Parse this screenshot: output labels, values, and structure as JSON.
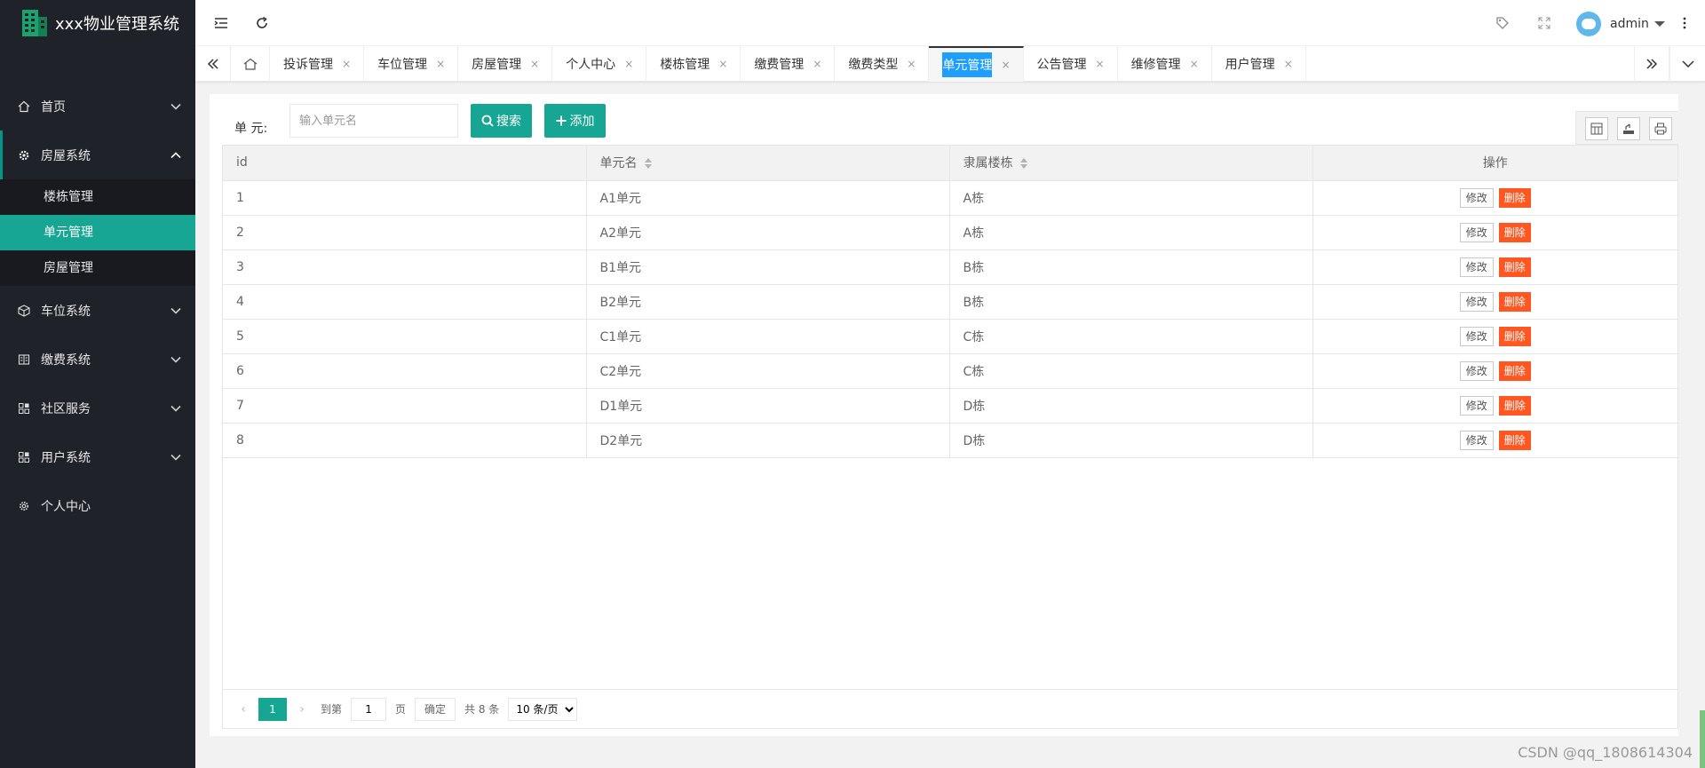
{
  "app": {
    "title": "xxx物业管理系统"
  },
  "sidebar": {
    "items": [
      {
        "label": "首页",
        "icon": "home-icon",
        "expandable": true
      },
      {
        "label": "房屋系统",
        "icon": "gear-icon",
        "expandable": true,
        "expanded": true,
        "children": [
          {
            "label": "楼栋管理"
          },
          {
            "label": "单元管理",
            "active": true
          },
          {
            "label": "房屋管理"
          }
        ]
      },
      {
        "label": "车位系统",
        "icon": "cube-icon",
        "expandable": true
      },
      {
        "label": "缴费系统",
        "icon": "ledger-icon",
        "expandable": true
      },
      {
        "label": "社区服务",
        "icon": "apps-icon",
        "expandable": true
      },
      {
        "label": "用户系统",
        "icon": "apps-icon",
        "expandable": true
      },
      {
        "label": "个人中心",
        "icon": "settings-icon",
        "expandable": false
      }
    ]
  },
  "header": {
    "user_name": "admin"
  },
  "tabs": {
    "items": [
      {
        "label": "投诉管理"
      },
      {
        "label": "车位管理"
      },
      {
        "label": "房屋管理"
      },
      {
        "label": "个人中心"
      },
      {
        "label": "楼栋管理"
      },
      {
        "label": "缴费管理"
      },
      {
        "label": "缴费类型"
      },
      {
        "label": "单元管理",
        "active": true
      },
      {
        "label": "公告管理"
      },
      {
        "label": "维修管理"
      },
      {
        "label": "用户管理"
      }
    ],
    "close_glyph": "×"
  },
  "search": {
    "label": "单 元:",
    "placeholder": "输入单元名",
    "search_label": "搜索",
    "add_label": "添加"
  },
  "table": {
    "columns": [
      "id",
      "单元名",
      "隶属楼栋",
      "操作"
    ],
    "rows": [
      {
        "id": "1",
        "name": "A1单元",
        "building": "A栋"
      },
      {
        "id": "2",
        "name": "A2单元",
        "building": "A栋"
      },
      {
        "id": "3",
        "name": "B1单元",
        "building": "B栋"
      },
      {
        "id": "4",
        "name": "B2单元",
        "building": "B栋"
      },
      {
        "id": "5",
        "name": "C1单元",
        "building": "C栋"
      },
      {
        "id": "6",
        "name": "C2单元",
        "building": "C栋"
      },
      {
        "id": "7",
        "name": "D1单元",
        "building": "D栋"
      },
      {
        "id": "8",
        "name": "D2单元",
        "building": "D栋"
      }
    ],
    "edit_label": "修改",
    "delete_label": "删除"
  },
  "pager": {
    "current": "1",
    "goto_label": "到第",
    "goto_value": "1",
    "page_unit": "页",
    "confirm_label": "确定",
    "total_label": "共 8 条",
    "page_size_option": "10 条/页"
  },
  "watermark": "CSDN @qq_1808614304",
  "colors": {
    "sidebar_bg": "#20222a",
    "accent": "#16a693",
    "danger": "#ff5722",
    "active_tab": "#1e9fff"
  }
}
